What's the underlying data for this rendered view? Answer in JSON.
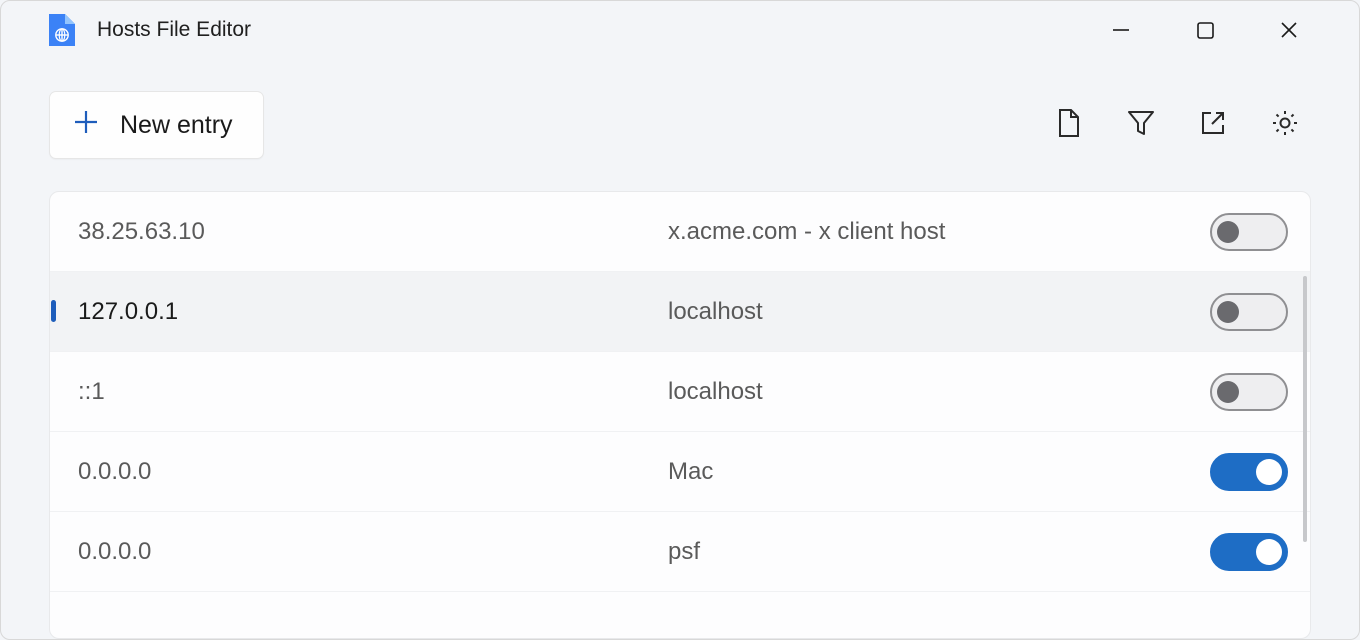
{
  "window": {
    "title": "Hosts File Editor"
  },
  "toolbar": {
    "new_entry_label": "New entry"
  },
  "hosts": [
    {
      "address": "38.25.63.10",
      "description": "x.acme.com - x client host",
      "enabled": false,
      "selected": false
    },
    {
      "address": "127.0.0.1",
      "description": "localhost",
      "enabled": false,
      "selected": true
    },
    {
      "address": "::1",
      "description": "localhost",
      "enabled": false,
      "selected": false
    },
    {
      "address": "0.0.0.0",
      "description": "Mac",
      "enabled": true,
      "selected": false
    },
    {
      "address": "0.0.0.0",
      "description": "psf",
      "enabled": true,
      "selected": false
    }
  ]
}
